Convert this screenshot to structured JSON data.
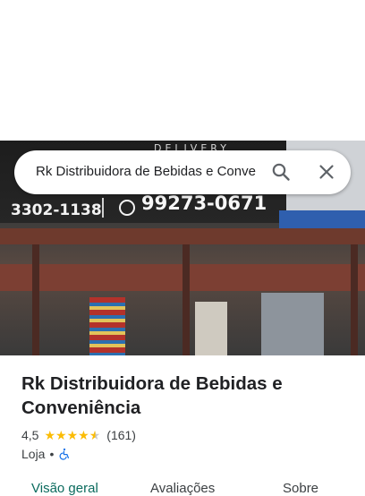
{
  "search": {
    "query": "Rk Distribuidora de Bebidas e Conveniência",
    "search_icon": "search-icon",
    "close_icon": "close-icon"
  },
  "photo": {
    "sign_delivery": "DELIVERY",
    "sign_phone_left": "3302-1138",
    "sign_phone_right": "99273-0671"
  },
  "place": {
    "name": "Rk Distribuidora de Bebidas e Conveniência",
    "rating": "4,5",
    "stars": 4.5,
    "review_count": "(161)",
    "category": "Loja",
    "separator": "•",
    "accessibility_icon": "wheelchair-icon"
  },
  "tabs": [
    {
      "label": "Visão geral",
      "active": true
    },
    {
      "label": "Avaliações",
      "active": false
    },
    {
      "label": "Sobre",
      "active": false
    }
  ],
  "colors": {
    "star": "#fbbc04",
    "active_tab": "#0b6b5e",
    "accessibility": "#1a73e8"
  }
}
